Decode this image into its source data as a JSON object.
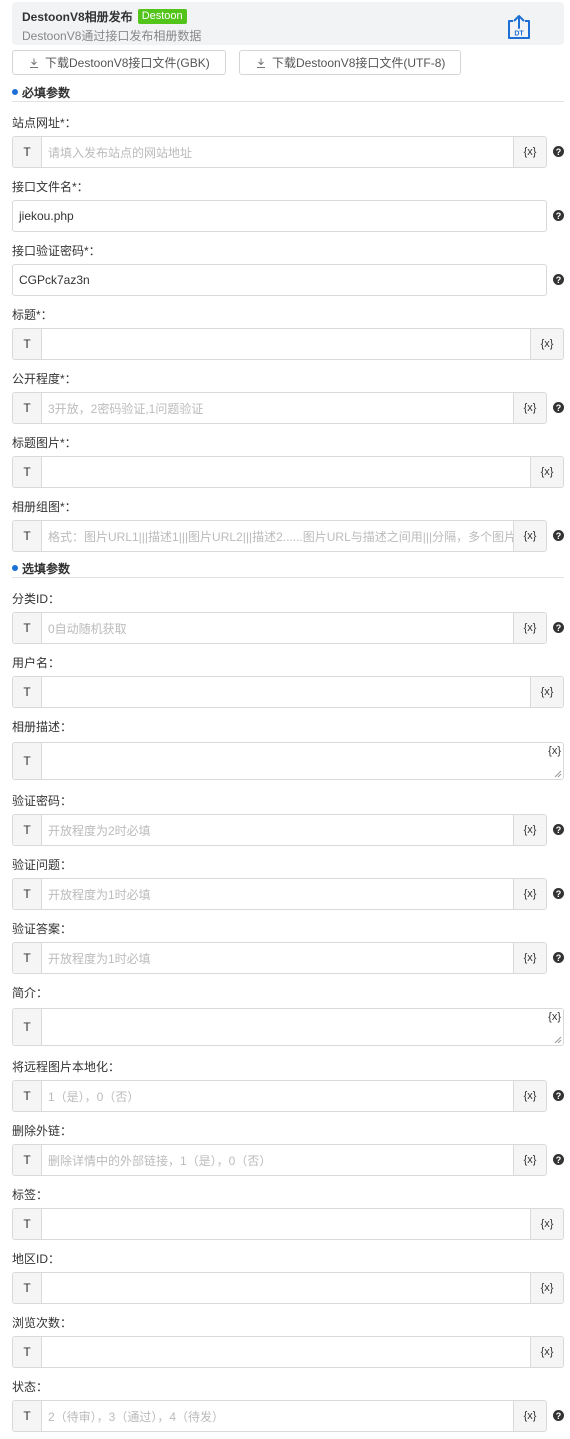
{
  "header": {
    "title": "DestoonV8相册发布",
    "badge": "Destoon",
    "description": "DestoonV8通过接口发布相册数据",
    "logo_icon": "dt-upload-icon",
    "logo_text": "DT"
  },
  "downloads": {
    "gbk_label": "下载DestoonV8接口文件(GBK)",
    "utf8_label": "下载DestoonV8接口文件(UTF-8)"
  },
  "sections": {
    "required": "必填参数",
    "optional": "选填参数"
  },
  "type_marker": "T",
  "var_marker": "{x}",
  "help_marker": "?",
  "fields": [
    {
      "label": "站点网址*：",
      "value": "",
      "placeholder": "请填入发布站点的网站地址"
    },
    {
      "label": "接口文件名*：",
      "value": "jiekou.php",
      "placeholder": ""
    },
    {
      "label": "接口验证密码*：",
      "value": "CGPck7az3n",
      "placeholder": ""
    },
    {
      "label": "标题*：",
      "value": "",
      "placeholder": ""
    },
    {
      "label": "公开程度*：",
      "value": "",
      "placeholder": "3开放，2密码验证,1问题验证"
    },
    {
      "label": "标题图片*：",
      "value": "",
      "placeholder": ""
    },
    {
      "label": "相册组图*：",
      "value": "",
      "placeholder": "格式：图片URL1|||描述1|||图片URL2|||描述2......图片URL与描述之间用|||分隔，多个图片"
    },
    {
      "label": "分类ID：",
      "value": "",
      "placeholder": "0自动随机获取"
    },
    {
      "label": "用户名：",
      "value": "",
      "placeholder": ""
    },
    {
      "label": "相册描述：",
      "value": "",
      "placeholder": ""
    },
    {
      "label": "验证密码：",
      "value": "",
      "placeholder": "开放程度为2时必填"
    },
    {
      "label": "验证问题：",
      "value": "",
      "placeholder": "开放程度为1时必填"
    },
    {
      "label": "验证答案：",
      "value": "",
      "placeholder": "开放程度为1时必填"
    },
    {
      "label": "简介：",
      "value": "",
      "placeholder": ""
    },
    {
      "label": "将远程图片本地化：",
      "value": "",
      "placeholder": "1（是），0（否）"
    },
    {
      "label": "删除外链：",
      "value": "",
      "placeholder": "删除详情中的外部链接，1（是），0（否）"
    },
    {
      "label": "标签：",
      "value": "",
      "placeholder": ""
    },
    {
      "label": "地区ID：",
      "value": "",
      "placeholder": ""
    },
    {
      "label": "浏览次数：",
      "value": "",
      "placeholder": ""
    },
    {
      "label": "状态：",
      "value": "",
      "placeholder": "2（待审），3（通过），4（待发）"
    }
  ]
}
